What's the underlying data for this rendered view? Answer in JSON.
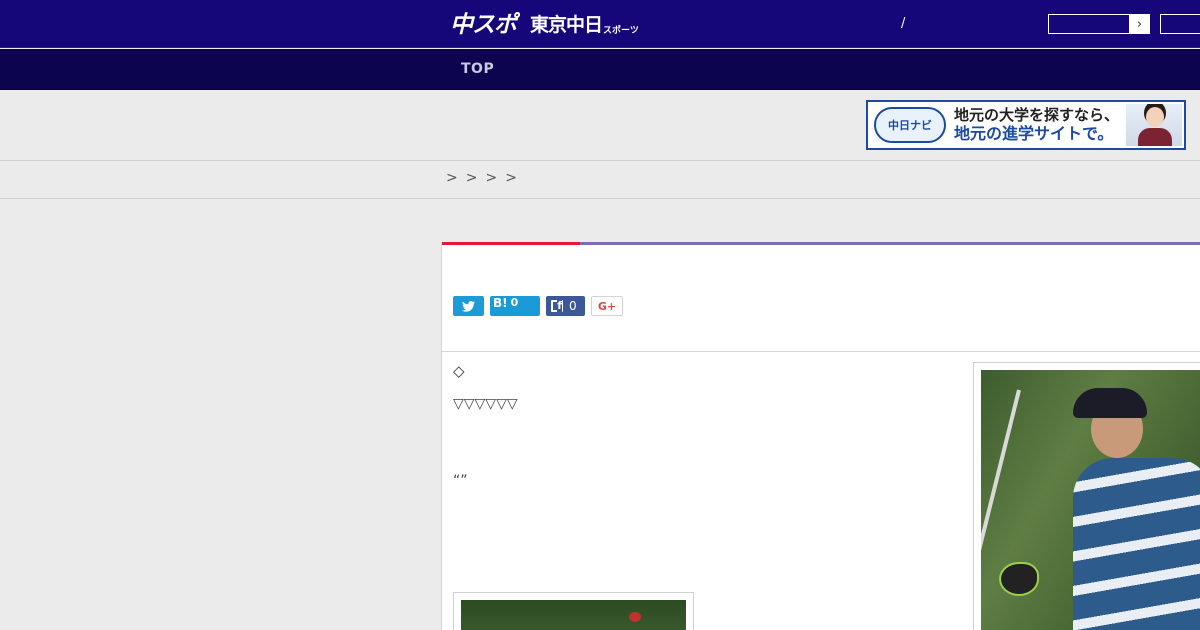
{
  "header": {
    "logo_main": "中スポ",
    "logo_sub": "東京中日",
    "logo_small": "スポーツ",
    "separator": "/",
    "search_button_glyph": "›"
  },
  "nav": {
    "top_label": "TOP"
  },
  "ad": {
    "logo_text": "中日ナビ",
    "line1": "地元の大学を探すなら、",
    "line2": "地元の進学サイトで。"
  },
  "breadcrumb": {
    "separators": [
      ">",
      ">",
      ">",
      ">"
    ]
  },
  "share": {
    "hatena_label": "B!",
    "hatena_count": "0",
    "facebook_count": "0",
    "google_label": "G+"
  },
  "article": {
    "text1": "◇",
    "text2": "▽▽▽▽▽▽",
    "text3": "“”"
  },
  "colors": {
    "header_bg": "#15067a",
    "nav_bg": "#0c044f",
    "accent_red": "#e8173a",
    "accent_purple": "#7d6bb3",
    "twitter": "#1d9bd8",
    "facebook": "#3b5998",
    "google": "#dd4b39"
  }
}
